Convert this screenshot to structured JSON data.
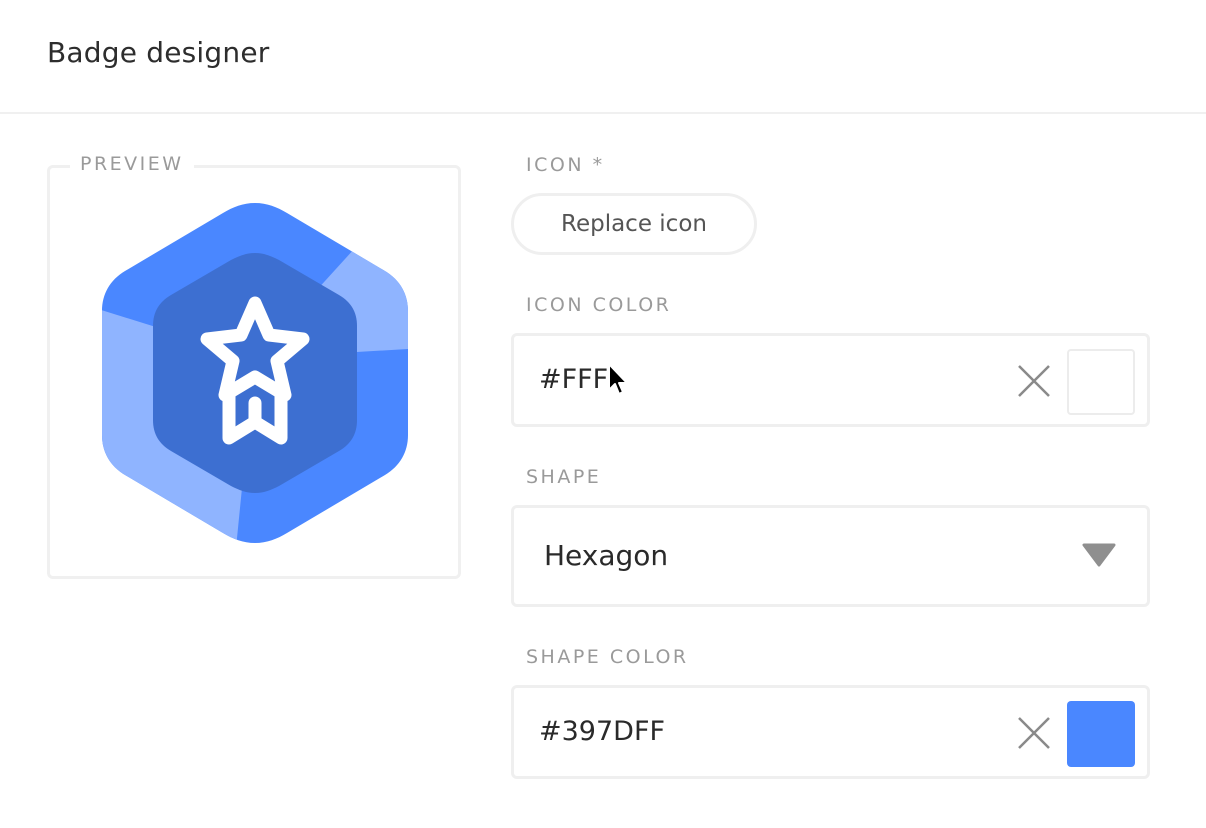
{
  "header": {
    "title": "Badge designer"
  },
  "preview": {
    "label": "PREVIEW",
    "badge_icon": "star-ribbon-icon",
    "shape": "hexagon"
  },
  "icon_field": {
    "label": "ICON *",
    "button_label": "Replace icon"
  },
  "icon_color_field": {
    "label": "ICON COLOR",
    "value": "#FFF",
    "swatch_color": "#FFFFFF",
    "clear_icon": "close-icon"
  },
  "shape_field": {
    "label": "SHAPE",
    "selected": "Hexagon",
    "dropdown_icon": "caret-down-icon"
  },
  "shape_color_field": {
    "label": "SHAPE COLOR",
    "value": "#397DFF",
    "swatch_color": "#4A87FF",
    "clear_icon": "close-icon"
  },
  "colors": {
    "badge_main": "#4A87FF",
    "badge_light": "#8FB4FF",
    "badge_inner": "#3D6FD1"
  }
}
